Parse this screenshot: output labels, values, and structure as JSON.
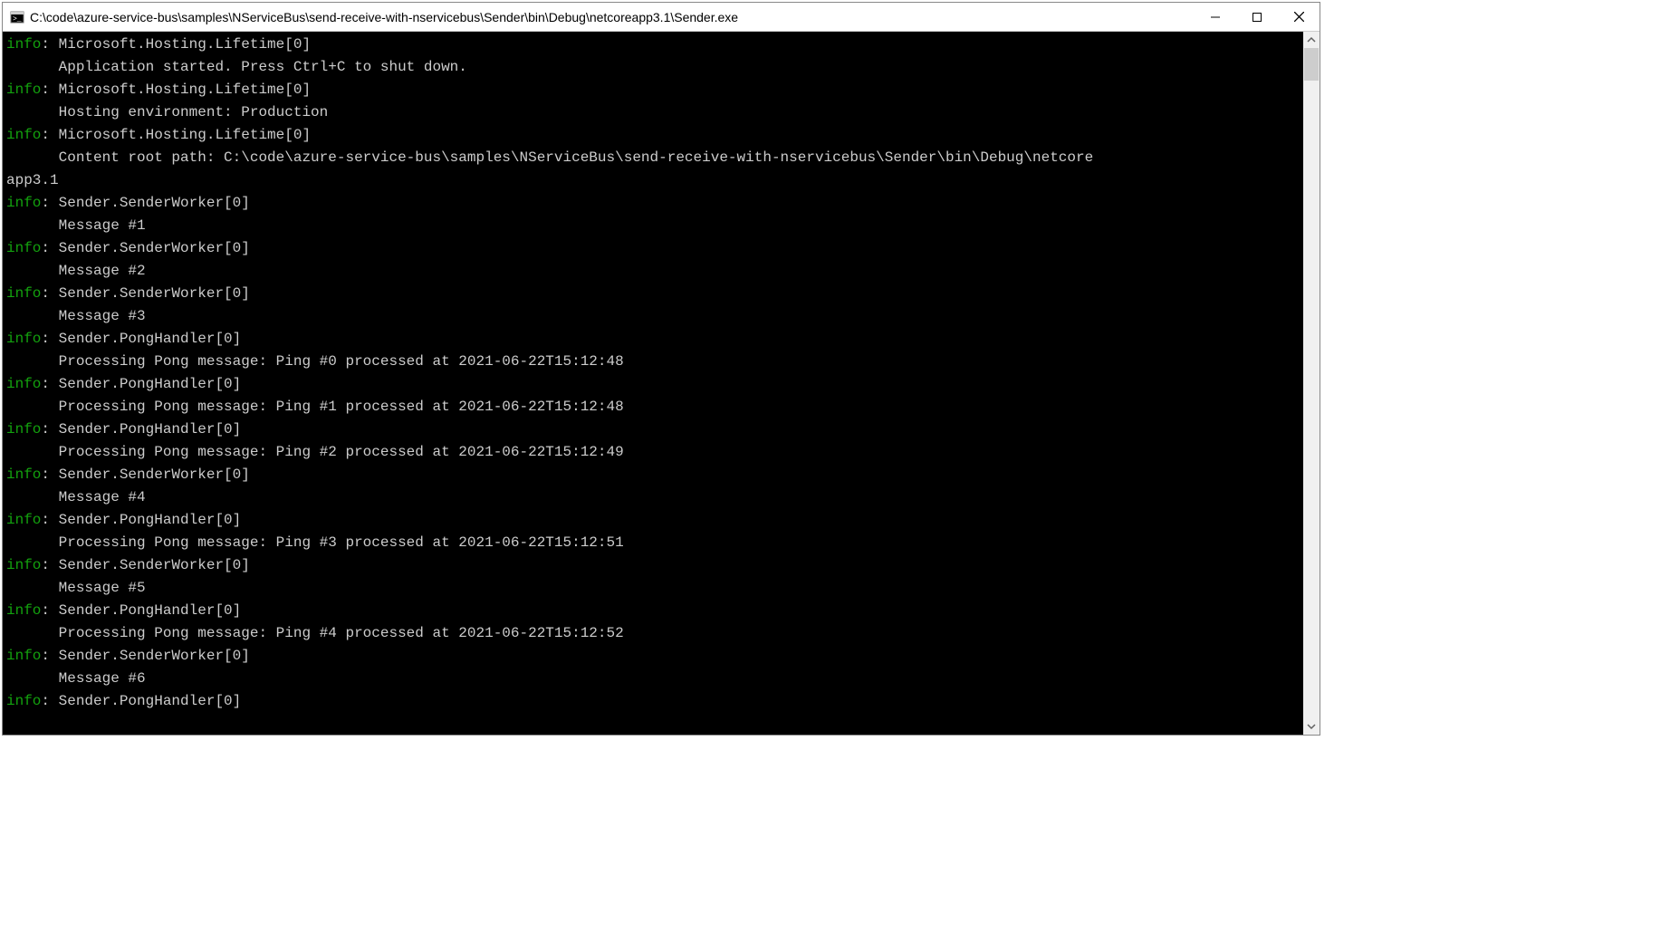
{
  "window": {
    "title": "C:\\code\\azure-service-bus\\samples\\NServiceBus\\send-receive-with-nservicebus\\Sender\\bin\\Debug\\netcoreapp3.1\\Sender.exe"
  },
  "log": {
    "prefix": "info",
    "sep": ": ",
    "entries": [
      {
        "src": "Microsoft.Hosting.Lifetime[0]",
        "msg": "Application started. Press Ctrl+C to shut down."
      },
      {
        "src": "Microsoft.Hosting.Lifetime[0]",
        "msg": "Hosting environment: Production"
      },
      {
        "src": "Microsoft.Hosting.Lifetime[0]",
        "msg": "Content root path: C:\\code\\azure-service-bus\\samples\\NServiceBus\\send-receive-with-nservicebus\\Sender\\bin\\Debug\\netcoreapp3.1",
        "wrap": true,
        "wrapSplit": 125
      },
      {
        "src": "Sender.SenderWorker[0]",
        "msg": "Message #1"
      },
      {
        "src": "Sender.SenderWorker[0]",
        "msg": "Message #2"
      },
      {
        "src": "Sender.SenderWorker[0]",
        "msg": "Message #3"
      },
      {
        "src": "Sender.PongHandler[0]",
        "msg": "Processing Pong message: Ping #0 processed at 2021-06-22T15:12:48"
      },
      {
        "src": "Sender.PongHandler[0]",
        "msg": "Processing Pong message: Ping #1 processed at 2021-06-22T15:12:48"
      },
      {
        "src": "Sender.PongHandler[0]",
        "msg": "Processing Pong message: Ping #2 processed at 2021-06-22T15:12:49"
      },
      {
        "src": "Sender.SenderWorker[0]",
        "msg": "Message #4"
      },
      {
        "src": "Sender.PongHandler[0]",
        "msg": "Processing Pong message: Ping #3 processed at 2021-06-22T15:12:51"
      },
      {
        "src": "Sender.SenderWorker[0]",
        "msg": "Message #5"
      },
      {
        "src": "Sender.PongHandler[0]",
        "msg": "Processing Pong message: Ping #4 processed at 2021-06-22T15:12:52"
      },
      {
        "src": "Sender.SenderWorker[0]",
        "msg": "Message #6"
      },
      {
        "src": "Sender.PongHandler[0]",
        "msg": "",
        "noMsgLine": true
      }
    ]
  },
  "colors": {
    "info": "#13a10e",
    "text": "#cccccc",
    "bg": "#000000"
  }
}
